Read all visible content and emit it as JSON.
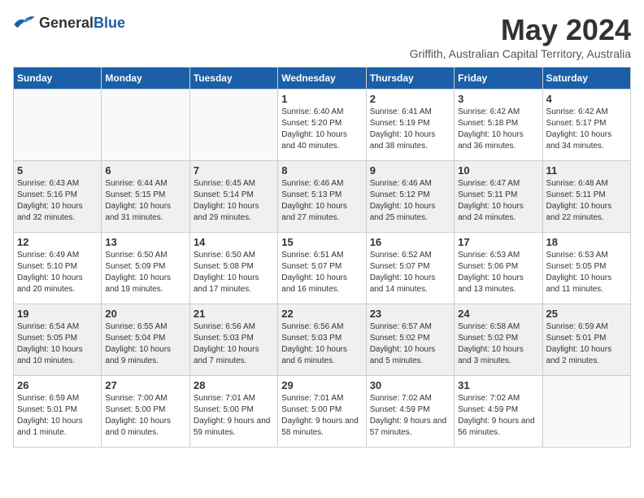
{
  "header": {
    "logo_general": "General",
    "logo_blue": "Blue",
    "month_year": "May 2024",
    "location": "Griffith, Australian Capital Territory, Australia"
  },
  "weekdays": [
    "Sunday",
    "Monday",
    "Tuesday",
    "Wednesday",
    "Thursday",
    "Friday",
    "Saturday"
  ],
  "weeks": [
    [
      {
        "day": "",
        "empty": true
      },
      {
        "day": "",
        "empty": true
      },
      {
        "day": "",
        "empty": true
      },
      {
        "day": "1",
        "sunrise": "6:40 AM",
        "sunset": "5:20 PM",
        "daylight": "10 hours and 40 minutes."
      },
      {
        "day": "2",
        "sunrise": "6:41 AM",
        "sunset": "5:19 PM",
        "daylight": "10 hours and 38 minutes."
      },
      {
        "day": "3",
        "sunrise": "6:42 AM",
        "sunset": "5:18 PM",
        "daylight": "10 hours and 36 minutes."
      },
      {
        "day": "4",
        "sunrise": "6:42 AM",
        "sunset": "5:17 PM",
        "daylight": "10 hours and 34 minutes."
      }
    ],
    [
      {
        "day": "5",
        "sunrise": "6:43 AM",
        "sunset": "5:16 PM",
        "daylight": "10 hours and 32 minutes."
      },
      {
        "day": "6",
        "sunrise": "6:44 AM",
        "sunset": "5:15 PM",
        "daylight": "10 hours and 31 minutes."
      },
      {
        "day": "7",
        "sunrise": "6:45 AM",
        "sunset": "5:14 PM",
        "daylight": "10 hours and 29 minutes."
      },
      {
        "day": "8",
        "sunrise": "6:46 AM",
        "sunset": "5:13 PM",
        "daylight": "10 hours and 27 minutes."
      },
      {
        "day": "9",
        "sunrise": "6:46 AM",
        "sunset": "5:12 PM",
        "daylight": "10 hours and 25 minutes."
      },
      {
        "day": "10",
        "sunrise": "6:47 AM",
        "sunset": "5:11 PM",
        "daylight": "10 hours and 24 minutes."
      },
      {
        "day": "11",
        "sunrise": "6:48 AM",
        "sunset": "5:11 PM",
        "daylight": "10 hours and 22 minutes."
      }
    ],
    [
      {
        "day": "12",
        "sunrise": "6:49 AM",
        "sunset": "5:10 PM",
        "daylight": "10 hours and 20 minutes."
      },
      {
        "day": "13",
        "sunrise": "6:50 AM",
        "sunset": "5:09 PM",
        "daylight": "10 hours and 19 minutes."
      },
      {
        "day": "14",
        "sunrise": "6:50 AM",
        "sunset": "5:08 PM",
        "daylight": "10 hours and 17 minutes."
      },
      {
        "day": "15",
        "sunrise": "6:51 AM",
        "sunset": "5:07 PM",
        "daylight": "10 hours and 16 minutes."
      },
      {
        "day": "16",
        "sunrise": "6:52 AM",
        "sunset": "5:07 PM",
        "daylight": "10 hours and 14 minutes."
      },
      {
        "day": "17",
        "sunrise": "6:53 AM",
        "sunset": "5:06 PM",
        "daylight": "10 hours and 13 minutes."
      },
      {
        "day": "18",
        "sunrise": "6:53 AM",
        "sunset": "5:05 PM",
        "daylight": "10 hours and 11 minutes."
      }
    ],
    [
      {
        "day": "19",
        "sunrise": "6:54 AM",
        "sunset": "5:05 PM",
        "daylight": "10 hours and 10 minutes."
      },
      {
        "day": "20",
        "sunrise": "6:55 AM",
        "sunset": "5:04 PM",
        "daylight": "10 hours and 9 minutes."
      },
      {
        "day": "21",
        "sunrise": "6:56 AM",
        "sunset": "5:03 PM",
        "daylight": "10 hours and 7 minutes."
      },
      {
        "day": "22",
        "sunrise": "6:56 AM",
        "sunset": "5:03 PM",
        "daylight": "10 hours and 6 minutes."
      },
      {
        "day": "23",
        "sunrise": "6:57 AM",
        "sunset": "5:02 PM",
        "daylight": "10 hours and 5 minutes."
      },
      {
        "day": "24",
        "sunrise": "6:58 AM",
        "sunset": "5:02 PM",
        "daylight": "10 hours and 3 minutes."
      },
      {
        "day": "25",
        "sunrise": "6:59 AM",
        "sunset": "5:01 PM",
        "daylight": "10 hours and 2 minutes."
      }
    ],
    [
      {
        "day": "26",
        "sunrise": "6:59 AM",
        "sunset": "5:01 PM",
        "daylight": "10 hours and 1 minute."
      },
      {
        "day": "27",
        "sunrise": "7:00 AM",
        "sunset": "5:00 PM",
        "daylight": "10 hours and 0 minutes."
      },
      {
        "day": "28",
        "sunrise": "7:01 AM",
        "sunset": "5:00 PM",
        "daylight": "9 hours and 59 minutes."
      },
      {
        "day": "29",
        "sunrise": "7:01 AM",
        "sunset": "5:00 PM",
        "daylight": "9 hours and 58 minutes."
      },
      {
        "day": "30",
        "sunrise": "7:02 AM",
        "sunset": "4:59 PM",
        "daylight": "9 hours and 57 minutes."
      },
      {
        "day": "31",
        "sunrise": "7:02 AM",
        "sunset": "4:59 PM",
        "daylight": "9 hours and 56 minutes."
      },
      {
        "day": "",
        "empty": true
      }
    ]
  ]
}
